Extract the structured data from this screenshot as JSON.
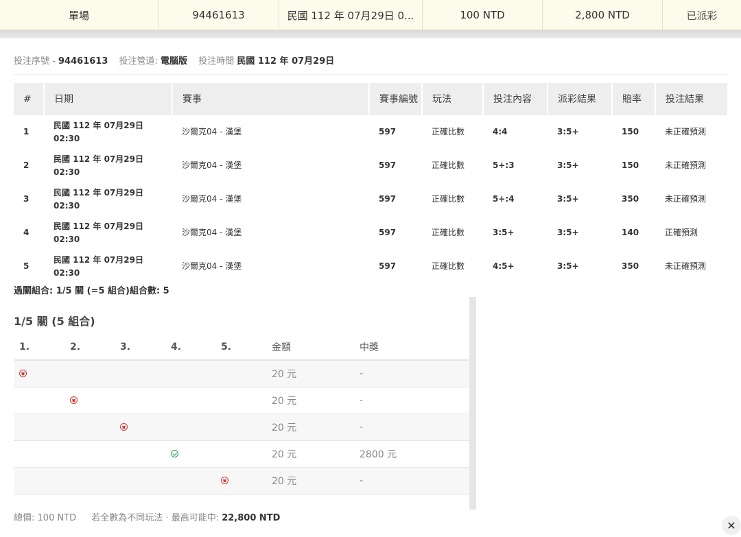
{
  "summary": [
    "單場",
    "94461613",
    "民國 112 年 07月29日 0...",
    "100 NTD",
    "2,800 NTD",
    "已派彩"
  ],
  "info": {
    "serial_label": "投注序號",
    "serial_sep": "-",
    "serial_value": "94461613",
    "channel_label": "投注管道:",
    "channel_value": "電腦版",
    "time_label": "投注時間",
    "time_value": "民國 112 年 07月29日"
  },
  "bets": {
    "headers": [
      "#",
      "日期",
      "賽事",
      "賽事編號",
      "玩法",
      "投注內容",
      "派彩結果",
      "賠率",
      "投注結果"
    ],
    "rows": [
      {
        "no": "1",
        "date": "民國 112 年 07月29日",
        "time": "02:30",
        "event": "沙爾克04 - 漢堡",
        "event_no": "597",
        "play": "正確比數",
        "content": "4:4",
        "result": "3:5+",
        "odds": "150",
        "outcome": "未正確預測"
      },
      {
        "no": "2",
        "date": "民國 112 年 07月29日",
        "time": "02:30",
        "event": "沙爾克04 - 漢堡",
        "event_no": "597",
        "play": "正確比數",
        "content": "5+:3",
        "result": "3:5+",
        "odds": "150",
        "outcome": "未正確預測"
      },
      {
        "no": "3",
        "date": "民國 112 年 07月29日",
        "time": "02:30",
        "event": "沙爾克04 - 漢堡",
        "event_no": "597",
        "play": "正確比數",
        "content": "5+:4",
        "result": "3:5+",
        "odds": "350",
        "outcome": "未正確預測"
      },
      {
        "no": "4",
        "date": "民國 112 年 07月29日",
        "time": "02:30",
        "event": "沙爾克04 - 漢堡",
        "event_no": "597",
        "play": "正確比數",
        "content": "3:5+",
        "result": "3:5+",
        "odds": "140",
        "outcome": "正確預測"
      },
      {
        "no": "5",
        "date": "民國 112 年 07月29日",
        "time": "02:30",
        "event": "沙爾克04 - 漢堡",
        "event_no": "597",
        "play": "正確比數",
        "content": "4:5+",
        "result": "3:5+",
        "odds": "350",
        "outcome": "未正確預測"
      }
    ]
  },
  "combo_summary": "過關組合: 1/5 關 (=5 組合)組合數: 5",
  "combos": {
    "title": "1/5 關 (5 組合)",
    "headers": [
      "1.",
      "2.",
      "3.",
      "4.",
      "5.",
      "金額",
      "中獎"
    ],
    "rows": [
      {
        "col": 1,
        "mark": "lose",
        "amount": "20 元",
        "prize": "-"
      },
      {
        "col": 2,
        "mark": "lose",
        "amount": "20 元",
        "prize": "-"
      },
      {
        "col": 3,
        "mark": "lose",
        "amount": "20 元",
        "prize": "-"
      },
      {
        "col": 4,
        "mark": "win",
        "amount": "20 元",
        "prize": "2800 元"
      },
      {
        "col": 5,
        "mark": "lose",
        "amount": "20 元",
        "prize": "-"
      }
    ]
  },
  "footer": {
    "total_label": "總價:",
    "total_value": "100 NTD",
    "note": "若全數為不同玩法 · 最高可能中:",
    "max_value": "22,800 NTD"
  },
  "close_glyph": "✕"
}
